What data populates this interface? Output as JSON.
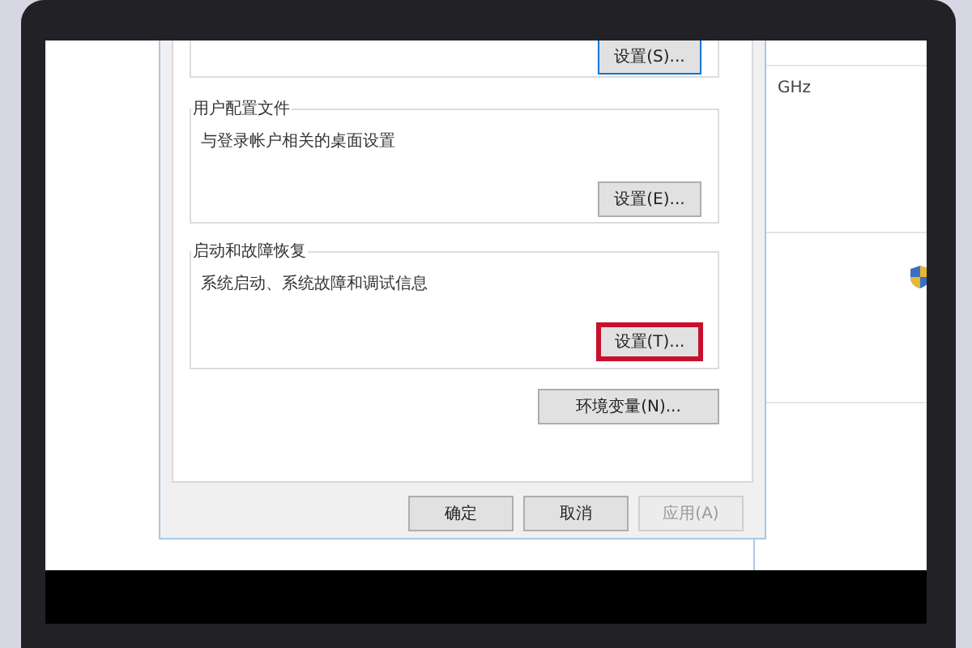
{
  "dialog": {
    "groups": [
      {
        "button": {
          "label": "设置(S)...",
          "highlighted": false,
          "focused": true
        }
      },
      {
        "legend": "用户配置文件",
        "description": "与登录帐户相关的桌面设置",
        "button": {
          "label": "设置(E)...",
          "highlighted": false,
          "focused": false
        }
      },
      {
        "legend": "启动和故障恢复",
        "description": "系统启动、系统故障和调试信息",
        "button": {
          "label": "设置(T)...",
          "highlighted": true,
          "focused": false
        }
      }
    ],
    "env_button": "环境变量(N)...",
    "buttons": [
      {
        "label": "确定",
        "disabled": false
      },
      {
        "label": "取消",
        "disabled": false
      },
      {
        "label": "应用(A)",
        "disabled": true
      }
    ]
  },
  "background_window": {
    "text": "GHz"
  }
}
